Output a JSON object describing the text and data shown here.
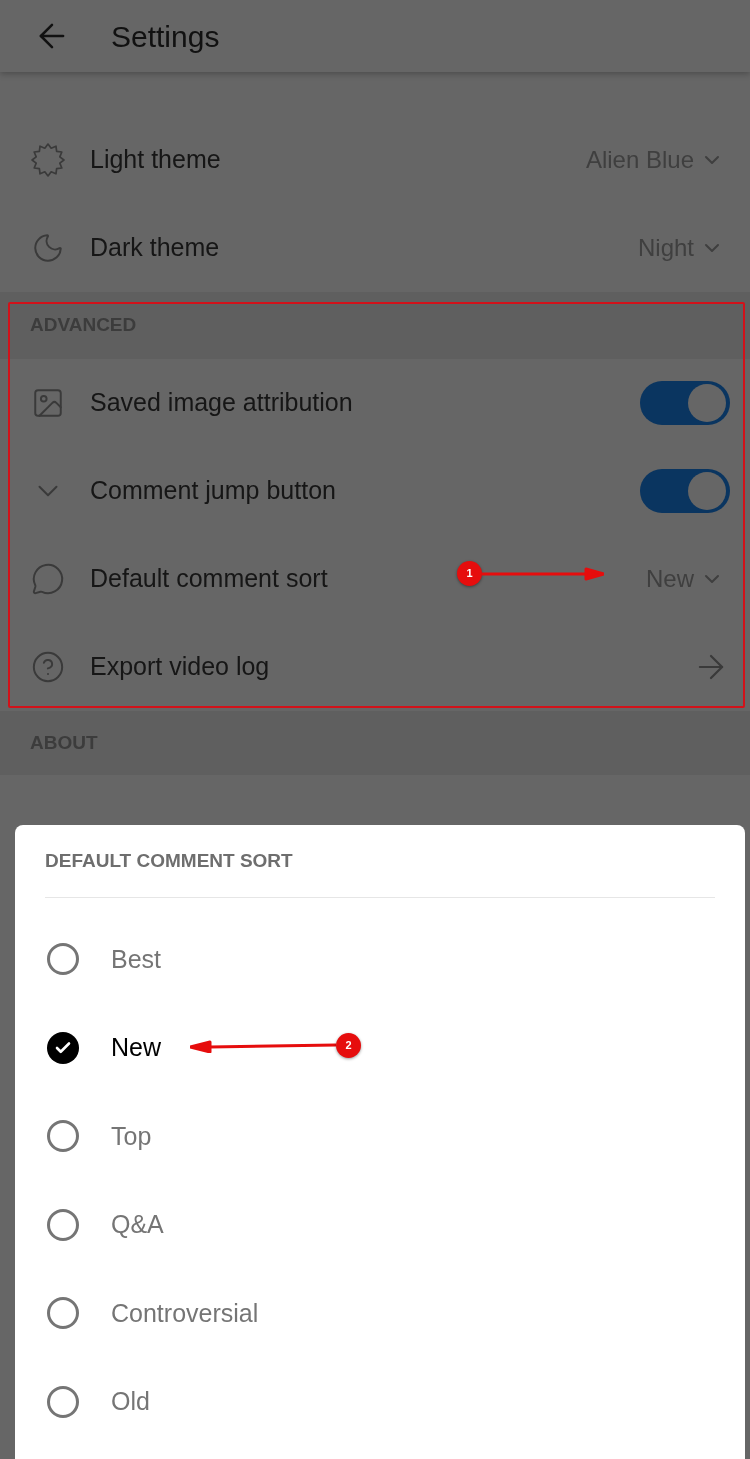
{
  "header": {
    "title": "Settings"
  },
  "sections": [
    {
      "items": [
        {
          "kind": "select",
          "label": "Light theme",
          "value": "Alien Blue"
        },
        {
          "kind": "select",
          "label": "Dark theme",
          "value": "Night"
        }
      ]
    },
    {
      "title": "ADVANCED",
      "highlighted": true,
      "items": [
        {
          "kind": "toggle",
          "label": "Saved image attribution",
          "on": true
        },
        {
          "kind": "toggle",
          "label": "Comment jump button",
          "on": true
        },
        {
          "kind": "select",
          "label": "Default comment sort",
          "value": "New"
        },
        {
          "kind": "link",
          "label": "Export video log"
        }
      ]
    },
    {
      "title": "ABOUT"
    }
  ],
  "sheet": {
    "title": "DEFAULT COMMENT SORT",
    "options": [
      {
        "label": "Best",
        "selected": false
      },
      {
        "label": "New",
        "selected": true
      },
      {
        "label": "Top",
        "selected": false
      },
      {
        "label": "Q&A",
        "selected": false
      },
      {
        "label": "Controversial",
        "selected": false
      },
      {
        "label": "Old",
        "selected": false
      }
    ]
  },
  "annotations": [
    {
      "label": "1"
    },
    {
      "label": "2"
    }
  ]
}
